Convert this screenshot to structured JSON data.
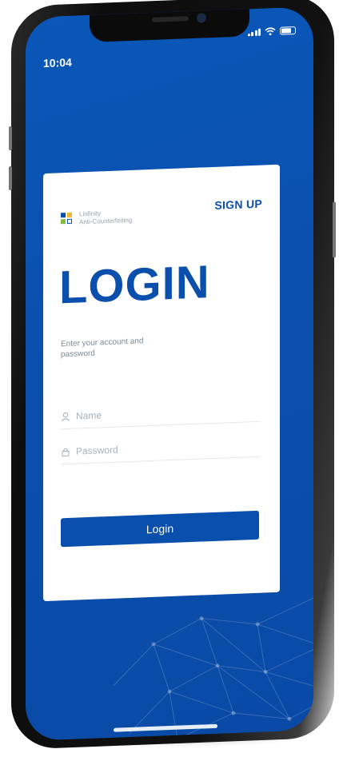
{
  "status_bar": {
    "time": "10:04"
  },
  "brand": {
    "line1": "Linfinity",
    "line2": "Anti-Counterfeiting"
  },
  "header": {
    "signup_label": "SIGN UP"
  },
  "main": {
    "title": "LOGIN",
    "subtitle": "Enter your account and password",
    "name_field": {
      "placeholder": "Name",
      "icon": "user-icon"
    },
    "password_field": {
      "placeholder": "Password",
      "icon": "lock-icon"
    },
    "login_button_label": "Login"
  },
  "colors": {
    "primary": "#0b4fad",
    "background_blue": "#0a57b8",
    "logo_green": "#7fbf3f",
    "logo_yellow": "#e8b82f"
  }
}
